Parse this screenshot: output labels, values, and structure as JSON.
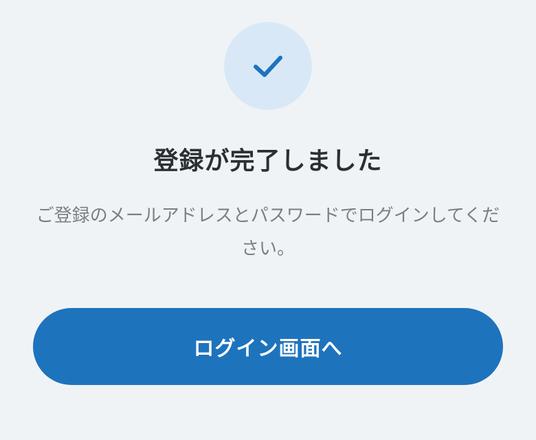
{
  "success": {
    "icon": "checkmark-icon",
    "title": "登録が完了しました",
    "message": "ご登録のメールアドレスとパスワードでログインしてください。"
  },
  "actions": {
    "login_button_label": "ログイン画面へ"
  },
  "colors": {
    "background": "#f0f3f5",
    "icon_circle": "#d8e8f6",
    "accent": "#1e73bd",
    "title_text": "#2b2f33",
    "body_text": "#7a7f85"
  }
}
